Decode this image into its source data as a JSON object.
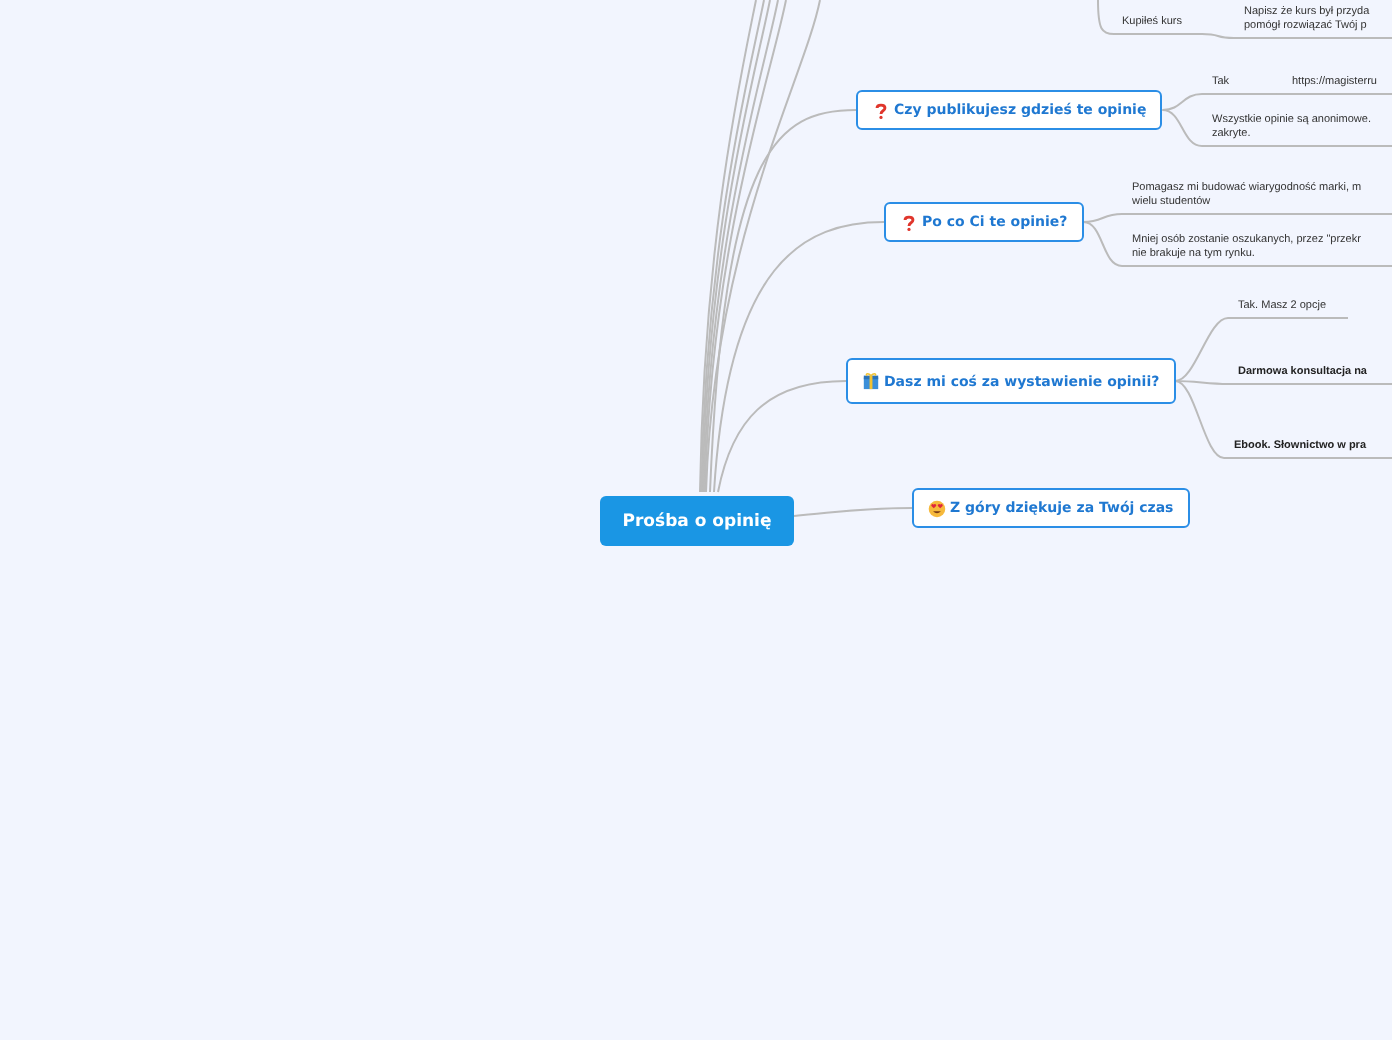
{
  "root": {
    "title": "Prośba o opinię"
  },
  "topics": [
    {
      "children": [
        {
          "text": "Kupiłeś kurs",
          "children": [
            {
              "text": "Napisz że kurs był przyda\npomógł rozwiązać Twój p"
            }
          ]
        }
      ]
    },
    {
      "title": "Czy publikujesz gdzieś te opinię",
      "kind": "question",
      "children": [
        {
          "text": "Tak",
          "children": [
            {
              "text": "https://magisterru"
            }
          ]
        },
        {
          "text": "Wszystkie opinie są anonimowe.\nzakryte."
        }
      ]
    },
    {
      "title": "Po co Ci te opinie?",
      "kind": "question",
      "children": [
        {
          "text": "Pomagasz mi budować wiarygodność marki, m\nwielu studentów"
        },
        {
          "text": "Mniej osób zostanie oszukanych, przez \"przekr\nnie brakuje na tym rynku."
        }
      ]
    },
    {
      "title": "Dasz mi coś za wystawienie opinii?",
      "kind": "gift",
      "children": [
        {
          "text": "Tak. Masz 2 opcje"
        },
        {
          "text": "Darmowa konsultacja na",
          "kind": "bold"
        },
        {
          "text": "Ebook. Słownictwo w pra",
          "kind": "bold"
        }
      ]
    },
    {
      "title": "Z góry dziękuje za Twój czas",
      "kind": "heart_eyes"
    }
  ]
}
